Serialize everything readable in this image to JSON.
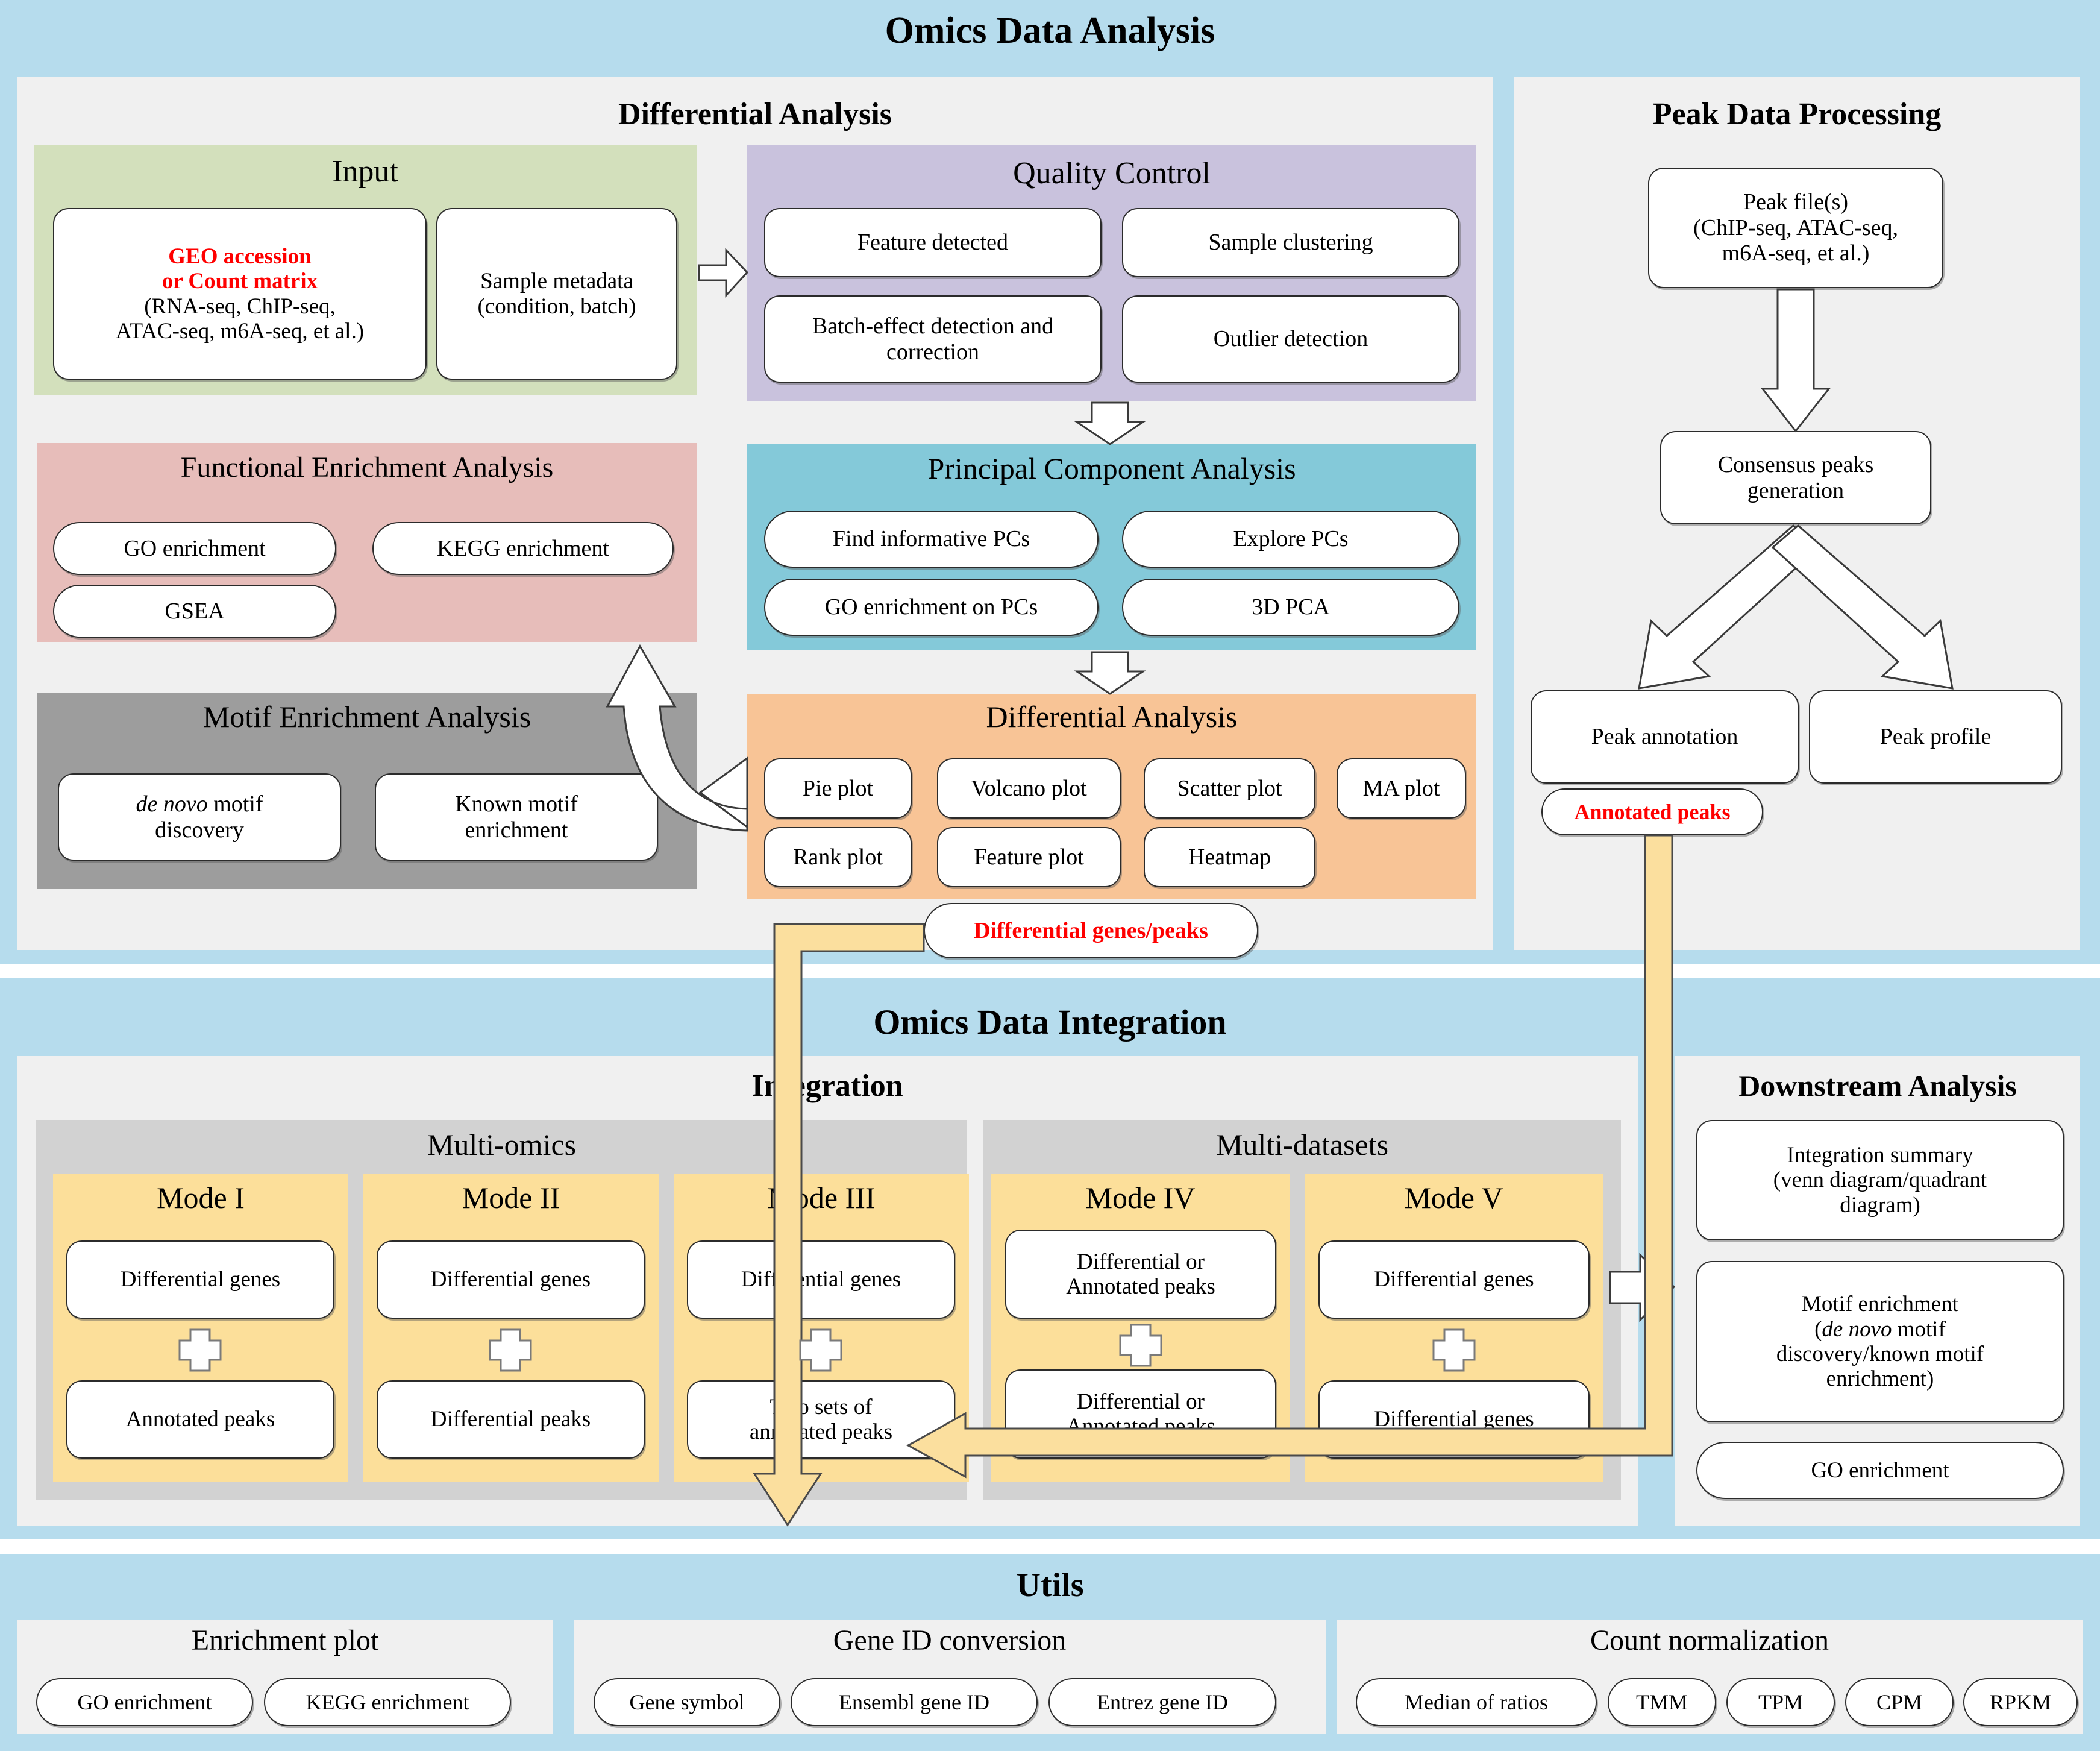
{
  "colors": {
    "outer_blue": "#b6dced",
    "group_gray": "#f0f0f0",
    "mid_gray": "#d2d2d2",
    "input_green": "#d3e0bc",
    "qc_purple": "#c9c2dd",
    "fea_pink": "#e7bdba",
    "pca_teal": "#84c9d9",
    "motif_darkgray": "#9d9d9d",
    "da_orange": "#f8c496",
    "mode_yellow": "#fcdf9a",
    "accent_red": "#ff0000",
    "arrow_yellow": "#fbdf9e"
  },
  "omics_data_analysis": {
    "title": "Omics Data Analysis",
    "differential_analysis_group": {
      "title": "Differential Analysis",
      "input": {
        "title": "Input",
        "boxes": [
          {
            "red_lines": [
              "GEO accession",
              "or Count matrix"
            ],
            "black_lines": [
              "(RNA-seq, ChIP-seq,",
              "ATAC-seq, m6A-seq, et al.)"
            ]
          },
          {
            "black_lines": [
              "Sample metadata",
              "(condition, batch)"
            ]
          }
        ]
      },
      "quality_control": {
        "title": "Quality Control",
        "items": [
          "Feature detected",
          "Sample clustering",
          "Batch-effect detection and correction",
          "Outlier detection"
        ]
      },
      "functional_enrichment": {
        "title": "Functional Enrichment Analysis",
        "items": [
          "GO enrichment",
          "KEGG enrichment",
          "GSEA"
        ]
      },
      "pca": {
        "title": "Principal Component Analysis",
        "items": [
          "Find informative PCs",
          "Explore PCs",
          "GO enrichment on PCs",
          "3D PCA"
        ]
      },
      "motif_enrichment": {
        "title": "Motif Enrichment Analysis",
        "items": [
          {
            "italic": "de novo",
            "rest": " motif",
            "line2": "discovery"
          },
          {
            "italic": "",
            "rest": "Known motif",
            "line2": "enrichment"
          }
        ]
      },
      "differential_analysis": {
        "title": "Differential Analysis",
        "items": [
          "Pie plot",
          "Volcano plot",
          "Scatter plot",
          "MA plot",
          "Rank plot",
          "Feature plot",
          "Heatmap"
        ]
      },
      "output_label": "Differential genes/peaks"
    },
    "peak_data_processing": {
      "title": "Peak Data Processing",
      "peak_files": [
        "Peak file(s)",
        "(ChIP-seq, ATAC-seq,",
        "m6A-seq, et al.)"
      ],
      "consensus": [
        "Consensus peaks",
        "generation"
      ],
      "peak_annotation": "Peak annotation",
      "peak_profile": "Peak profile",
      "output_label": "Annotated peaks"
    }
  },
  "omics_data_integration": {
    "title": "Omics Data Integration",
    "integration_label": "Integration",
    "multi_omics": {
      "title": "Multi-omics",
      "modes": [
        {
          "name": "Mode I",
          "top": "Differential genes",
          "bottom_lines": [
            "Annotated peaks"
          ]
        },
        {
          "name": "Mode II",
          "top": "Differential genes",
          "bottom_lines": [
            "Differential peaks"
          ]
        },
        {
          "name": "Mode III",
          "top": "Differential genes",
          "bottom_lines": [
            "Two sets of",
            "annotated peaks"
          ]
        }
      ]
    },
    "multi_datasets": {
      "title": "Multi-datasets",
      "modes": [
        {
          "name": "Mode IV",
          "top_lines": [
            "Differential or",
            "Annotated  peaks"
          ],
          "bottom_lines": [
            "Differential or",
            "Annotated  peaks"
          ]
        },
        {
          "name": "Mode V",
          "top_lines": [
            "Differential genes"
          ],
          "bottom_lines": [
            "Differential genes"
          ]
        }
      ]
    },
    "downstream_analysis": {
      "title": "Downstream Analysis",
      "items": [
        {
          "lines": [
            "Integration summary",
            "(venn diagram/quadrant",
            "diagram)"
          ]
        },
        {
          "lines": [
            "Motif enrichment",
            "(de novo motif",
            "discovery/known motif",
            "enrichment)"
          ],
          "italic_part": "de novo"
        },
        {
          "lines": [
            "GO enrichment"
          ]
        }
      ]
    }
  },
  "utils": {
    "title": "Utils",
    "groups": [
      {
        "title": "Enrichment plot",
        "items": [
          "GO enrichment",
          "KEGG enrichment"
        ]
      },
      {
        "title": "Gene ID conversion",
        "items": [
          "Gene symbol",
          "Ensembl gene ID",
          "Entrez gene ID"
        ]
      },
      {
        "title": "Count normalization",
        "items": [
          "Median of ratios",
          "TMM",
          "TPM",
          "CPM",
          "RPKM"
        ]
      }
    ]
  }
}
